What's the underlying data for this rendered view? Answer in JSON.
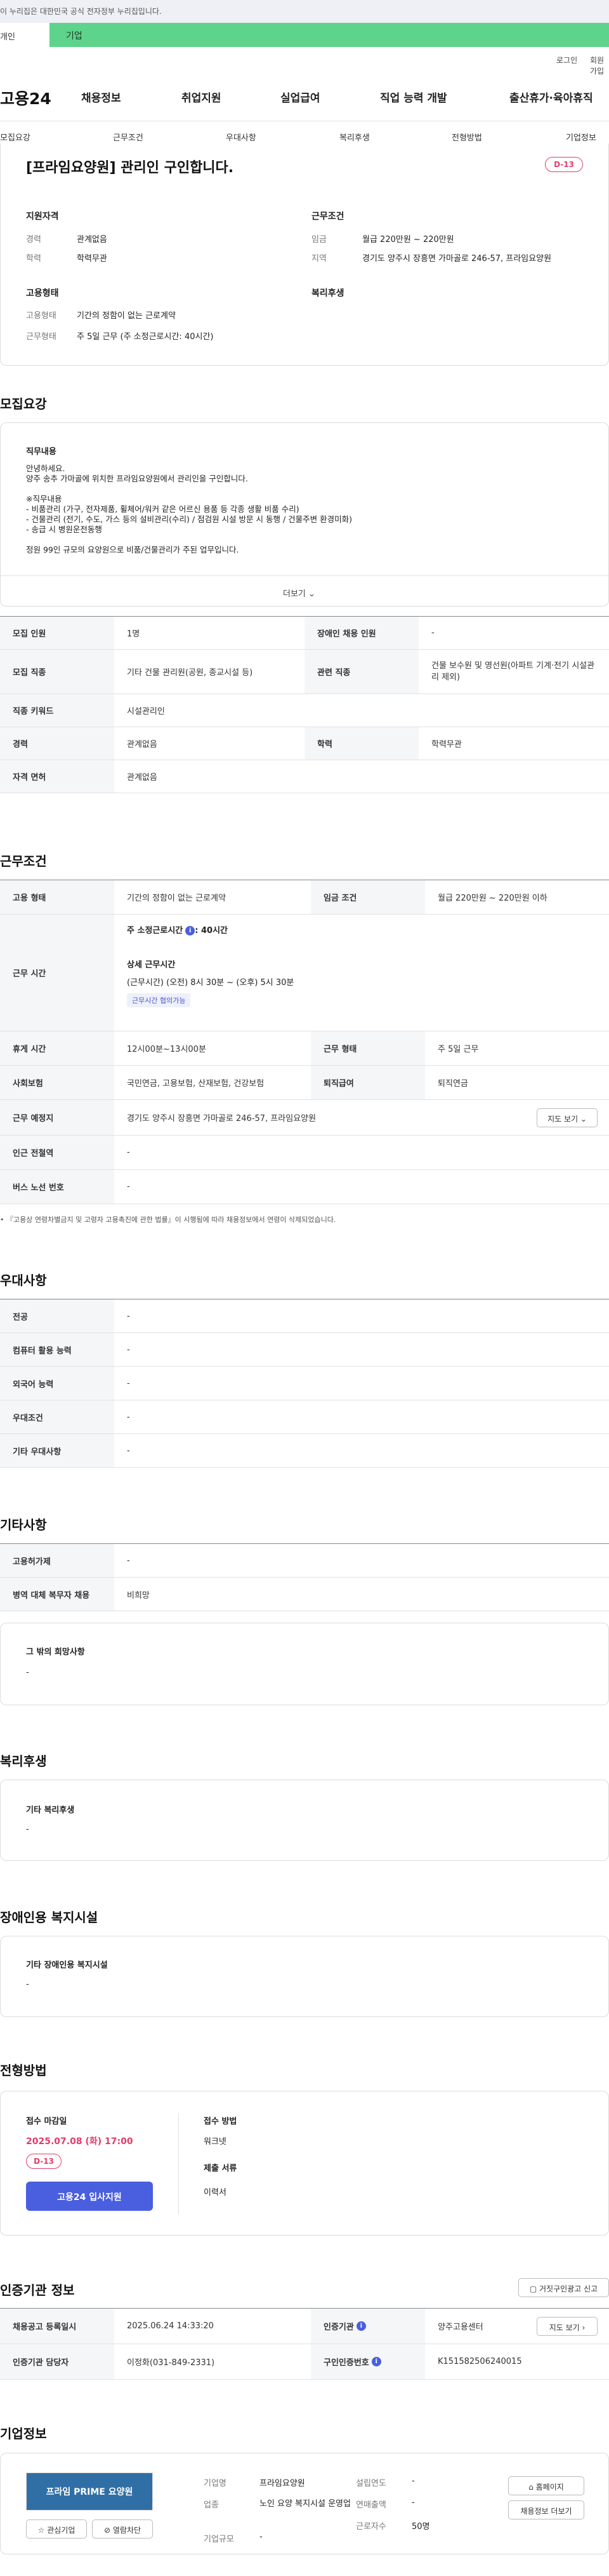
{
  "gov_notice": "이 누리집은 대한민국 공식 전자정부 누리집입니다.",
  "tabs": {
    "indiv": "개인",
    "corp": "기업"
  },
  "util": {
    "login": "로그인",
    "join": "회원가입"
  },
  "logo": "고용24",
  "gnb": [
    "채용정보",
    "취업지원",
    "실업급여",
    "직업 능력 개발",
    "출산휴가·육아휴직"
  ],
  "subnav": [
    "모집요강",
    "근무조건",
    "우대사항",
    "복리후생",
    "전형방법",
    "기업정보"
  ],
  "header": {
    "title": "[프라임요양원] 관리인 구인합니다.",
    "dday": "D-13",
    "req_label": "지원자격",
    "cond_label": "근무조건",
    "emp_label": "고용형태",
    "welfare_label": "복리후생",
    "career_k": "경력",
    "career_v": "관계없음",
    "edu_k": "학력",
    "edu_v": "학력무관",
    "wage_k": "임금",
    "wage_v": "월급 220만원 ~ 220만원",
    "region_k": "지역",
    "region_v": "경기도 양주시 장흥면 가마골로 246-57, 프라임요양원",
    "emptype_k": "고용형태",
    "emptype_v": "기간의 정함이 없는 근로계약",
    "worktype_k": "근무형태",
    "worktype_v": "주 5일 근무 (주 소정근로시간: 40시간)"
  },
  "recruit": {
    "title": "모집요강",
    "duty_label": "직무내용",
    "duty_lines": [
      "안녕하세요.",
      "양주 송추 가마골에 위치한 프라임요양원에서 관리인을 구인합니다.",
      "",
      "※직무내용",
      " - 비품관리 (가구, 전자제품, 휠체어/워커 같은 어르신 용품 등 각종 생활 비품 수리)",
      " - 건물관리 (전기, 수도, 가스 등의 설비관리(수리) / 점검원 시설 방문 시 동행 / 건물주변 환경미화)",
      " - 송급 시 병원운전동행",
      "",
      "정원 99인 규모의 요양원으로 비품/건물관리가 주된 업무입니다."
    ],
    "more": "더보기",
    "rows": [
      {
        "k1": "모집 인원",
        "v1": "1명",
        "k2": "장애인 채용 인원",
        "v2": "-"
      },
      {
        "k1": "모집 직종",
        "v1": "기타 건물 관리원(공원, 종교시설 등)",
        "k2": "관련 직종",
        "v2": "건물 보수원 및 영선원(아파트 기계·전기 시설관리 제외)"
      },
      {
        "k1": "직종 키워드",
        "v1": "시설관리인"
      },
      {
        "k1": "경력",
        "v1": "관계없음",
        "k2": "학력",
        "v2": "학력무관"
      },
      {
        "k1": "자격 면허",
        "v1": "관계없음"
      }
    ]
  },
  "conditions": {
    "title": "근무조건",
    "emp_k": "고용 형태",
    "emp_v": "기간의 정함이 없는 근로계약",
    "wage_k": "임금 조건",
    "wage_v": "월급 220만원 ~ 220만원 이하",
    "hours_k": "근무 시간",
    "std_hours": "주 소정근로시간",
    "std_hours_v": ": 40시간",
    "detail_label": "상세 근무시간",
    "detail_v": "(근무시간) (오전) 8시 30분 ~ (오후) 5시 30분",
    "chip": "근무시간 협의가능",
    "break_k": "휴게 시간",
    "break_v": "12시00분~13시00분",
    "worktype_k": "근무 형태",
    "worktype_v": "주 5일 근무",
    "ins_k": "사회보험",
    "ins_v": "국민연금, 고용보험, 산재보험, 건강보험",
    "retire_k": "퇴직급여",
    "retire_v": "퇴직연금",
    "place_k": "근무 예정지",
    "place_v": "경기도 양주시 장흥면 가마골로 246-57, 프라임요양원",
    "map_btn": "지도 보기",
    "subway_k": "인근 전철역",
    "subway_v": "-",
    "bus_k": "버스 노선 번호",
    "bus_v": "-",
    "note": "『고용상 연령차별금지 및 고령자 고용촉진에 관한 법률』이 시행됨에 따라 채용정보에서 연령이 삭제되었습니다."
  },
  "preferred": {
    "title": "우대사항",
    "rows": [
      {
        "k": "전공",
        "v": "-"
      },
      {
        "k": "컴퓨터 활용 능력",
        "v": "-"
      },
      {
        "k": "외국어 능력",
        "v": "-"
      },
      {
        "k": "우대조건",
        "v": "-"
      },
      {
        "k": "기타 우대사항",
        "v": "-"
      }
    ]
  },
  "other": {
    "title": "기타사항",
    "rows": [
      {
        "k": "고용허가제",
        "v": "-"
      },
      {
        "k": "병역 대체 복무자 채용",
        "v": "비희망"
      }
    ],
    "etc_label": "그 밖의 희망사항",
    "etc_v": "-"
  },
  "welfare": {
    "title": "복리후생",
    "label": "기타 복리후생",
    "v": "-"
  },
  "disabled": {
    "title": "장애인용 복지시설",
    "label": "기타 장애인용 복지시설",
    "v": "-"
  },
  "selection": {
    "title": "전형방법",
    "deadline_label": "접수 마감일",
    "deadline_v": "2025.07.08 (화) 17:00",
    "dday": "D-13",
    "apply_btn": "고용24 입사지원",
    "method_label": "접수 방법",
    "method_v": "워크넷",
    "docs_label": "제출 서류",
    "docs_v": "이력서"
  },
  "agency": {
    "title": "인증기관 정보",
    "report_btn": "거짓구인광고 신고",
    "reg_k": "채용공고 등록일시",
    "reg_v": "2025.06.24 14:33:20",
    "org_k": "인증기관",
    "org_v": "양주고용센터",
    "map_btn": "지도 보기",
    "mgr_k": "인증기관 담당자",
    "mgr_v": "이정화(031-849-2331)",
    "no_k": "구인인증번호",
    "no_v": "K151582506240015"
  },
  "company": {
    "title": "기업정보",
    "logo_text": "프라임 PRIME 요양원",
    "fav_btn": "관심기업",
    "block_btn": "열람차단",
    "name_k": "기업명",
    "name_v": "프라임요양원",
    "biz_k": "업종",
    "biz_v": "노인 요양 복지시설 운영업",
    "scale_k": "기업규모",
    "scale_v": "-",
    "est_k": "설립연도",
    "est_v": "-",
    "sales_k": "연매출액",
    "sales_v": "-",
    "emp_k": "근로자수",
    "emp_v": "50명",
    "home_btn": "홈페이지",
    "jobs_btn": "채용정보 더보기"
  }
}
